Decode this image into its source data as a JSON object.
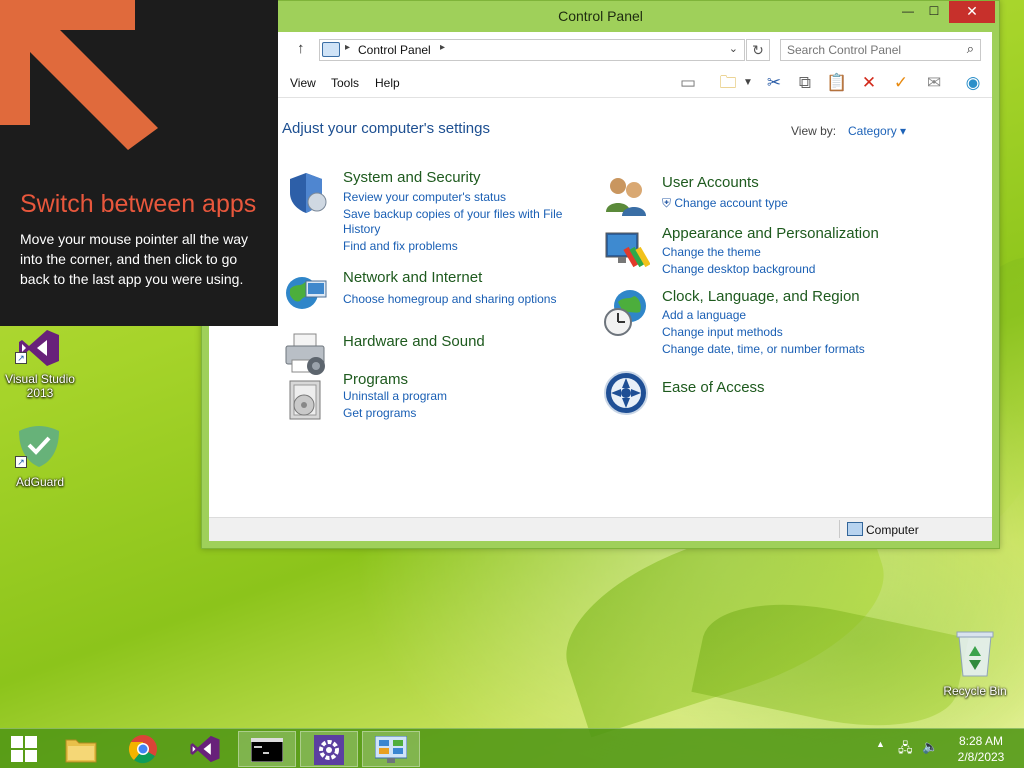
{
  "window": {
    "title": "Control Panel",
    "controls": {
      "minimize": "—",
      "maximize": "☐",
      "close": "✕"
    }
  },
  "address": {
    "location": "Control Panel"
  },
  "search": {
    "placeholder": "Search Control Panel"
  },
  "menu": {
    "view": "View",
    "tools": "Tools",
    "help": "Help"
  },
  "toolbar_icons": [
    "layout-icon",
    "properties-folder-icon",
    "cut-icon",
    "copy-icon",
    "paste-icon",
    "delete-icon",
    "check-icon",
    "email-icon",
    "globe-icon"
  ],
  "main": {
    "heading": "Adjust your computer's settings",
    "view_by_label": "View by:",
    "view_by_value": "Category"
  },
  "categories": {
    "system_security": {
      "title": "System and Security",
      "links": [
        "Review your computer's status",
        "Save backup copies of your files with File",
        "History",
        "Find and fix problems"
      ]
    },
    "network": {
      "title": "Network and Internet",
      "links": [
        "Choose homegroup and sharing options"
      ]
    },
    "hardware": {
      "title": "Hardware and Sound"
    },
    "programs": {
      "title": "Programs",
      "links": [
        "Uninstall a program",
        "Get programs"
      ]
    },
    "user_accounts": {
      "title": "User Accounts",
      "links": [
        "Change account type"
      ]
    },
    "appearance": {
      "title": "Appearance and Personalization",
      "links": [
        "Change the theme",
        "Change desktop background"
      ]
    },
    "clock": {
      "title": "Clock, Language, and Region",
      "links": [
        "Add a language",
        "Change input methods",
        "Change date, time, or number formats"
      ]
    },
    "ease": {
      "title": "Ease of Access"
    }
  },
  "status": {
    "text": "Computer"
  },
  "tip": {
    "title": "Switch between apps",
    "body": "Move your mouse pointer all the way into the corner, and then click to go back to the last app you were using."
  },
  "desktop": {
    "vs_label_1": "Visual Studio",
    "vs_label_2": "2013",
    "adguard_label": "AdGuard",
    "recycle_label": "Recycle Bin"
  },
  "taskbar": {
    "time": "8:28 AM",
    "date": "2/8/2023"
  },
  "colors": {
    "accent_green": "#9fd05a",
    "close_red": "#c7302b",
    "tip_title": "#e8573c",
    "link_blue": "#1a5fb4",
    "category_green": "#1e5a1e"
  }
}
